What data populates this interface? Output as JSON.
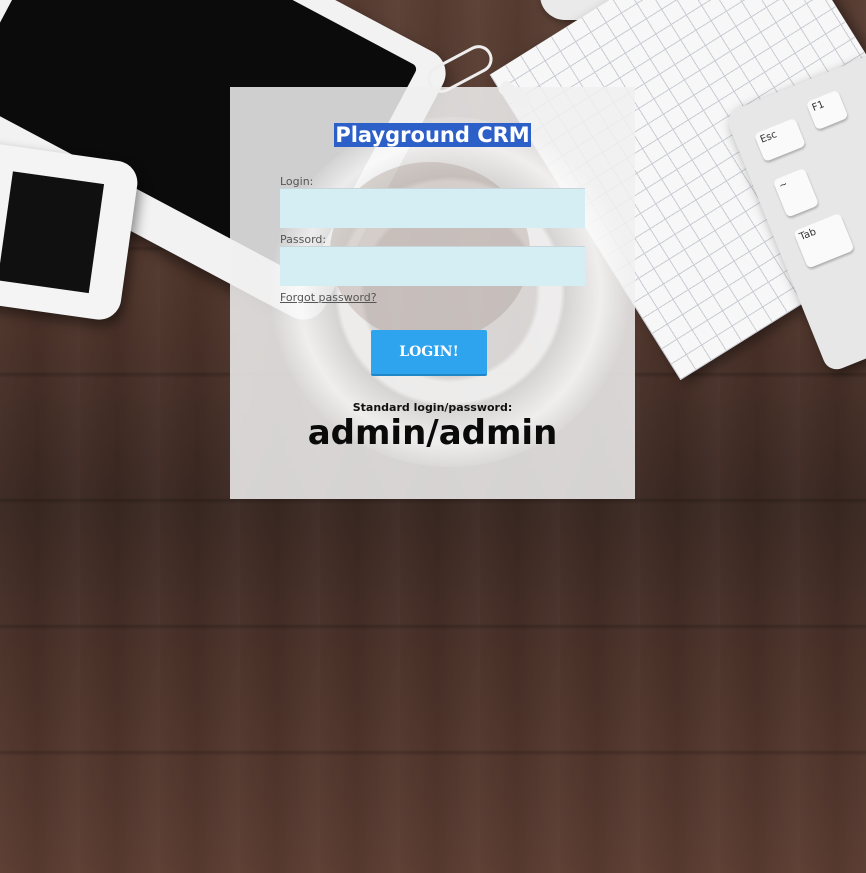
{
  "app": {
    "title": "Playground CRM"
  },
  "form": {
    "login_label": "Login:",
    "login_value": "",
    "password_label": "Passord:",
    "password_value": "",
    "forgot_link": "Forgot password?",
    "submit_label": "LOGIN!"
  },
  "hint": {
    "label": "Standard login/password:",
    "value": "admin/admin"
  },
  "background": {
    "key_labels": [
      "Esc",
      "F1",
      "~",
      "Tab"
    ]
  },
  "colors": {
    "title_bg": "#2d5fc8",
    "button_bg": "#2ea4ee",
    "field_bg": "#d5eef3"
  }
}
